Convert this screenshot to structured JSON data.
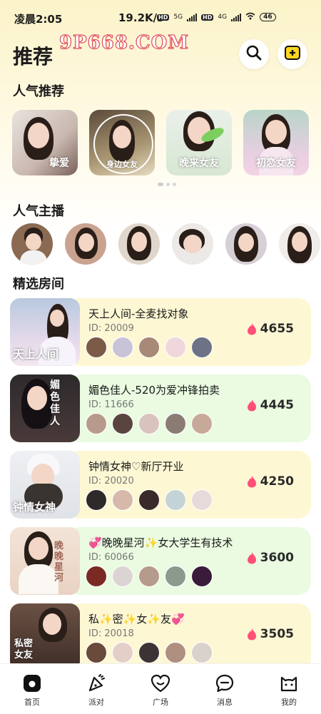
{
  "status_bar": {
    "time": "凌晨2:05",
    "speed": "19.2K/s",
    "hd1": "HD",
    "net1": "5G",
    "hd2": "HD",
    "net2": "4G",
    "battery": "46"
  },
  "header": {
    "title": "推荐",
    "watermark": "9P668.COM",
    "search_icon": "search-icon",
    "add_icon": "add-icon"
  },
  "sections": {
    "hot_recommend": "人气推荐",
    "hot_anchors": "人气主播",
    "featured_rooms": "精选房间"
  },
  "hot_recommend": [
    {
      "caption": "挚爱"
    },
    {
      "caption": "身边女友"
    },
    {
      "caption": "晚来女友"
    },
    {
      "caption": "初恋女友"
    }
  ],
  "rooms": [
    {
      "thumb_caption": "天上人间",
      "name": "天上人间-全麦找对象",
      "id": "ID: 20009",
      "heat": "4655"
    },
    {
      "thumb_caption": "媚色佳人",
      "name": "媚色佳人-520为爱冲锋拍卖",
      "id": "ID: 11666",
      "heat": "4445"
    },
    {
      "thumb_caption": "钟情女神",
      "name": "钟情女神♡新厅开业",
      "id": "ID: 20020",
      "heat": "4250"
    },
    {
      "thumb_caption": "晚晚星河",
      "name": "💞晚晚星河✨女大学生有技术",
      "id": "ID: 60066",
      "heat": "3600"
    },
    {
      "thumb_caption": "私密女友",
      "name": "私✨密✨女✨友💞",
      "id": "ID: 20018",
      "heat": "3505"
    }
  ],
  "tabs": [
    {
      "label": "首页",
      "icon": "home-icon"
    },
    {
      "label": "派对",
      "icon": "party-icon"
    },
    {
      "label": "广场",
      "icon": "plaza-icon"
    },
    {
      "label": "消息",
      "icon": "message-icon"
    },
    {
      "label": "我的",
      "icon": "profile-icon"
    }
  ],
  "colors": {
    "accent": "#ffd61f",
    "heat": "#ff4f78",
    "room_yellow": "#fdf7d4",
    "room_green": "#eafbe1"
  }
}
